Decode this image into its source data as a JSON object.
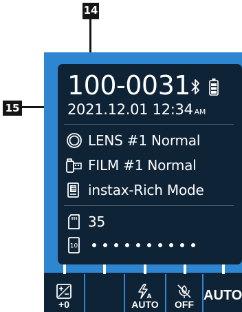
{
  "callouts": {
    "shot_number": "14",
    "date": "15"
  },
  "status": {
    "shot_number": "100-0031",
    "date": "2021.12.01",
    "time": "12:34",
    "ampm": "AM"
  },
  "settings": {
    "lens": "LENS #1 Normal",
    "film": "FILM #1 Normal",
    "mode": "instax-Rich Mode",
    "remaining": "35"
  },
  "film_pack": {
    "remaining_dots": 10
  },
  "buttons": {
    "exposure": "+0",
    "flash": "AUTO",
    "macro": "OFF",
    "auto": "AUTO"
  },
  "icons": {
    "lens": "lens-ring-icon",
    "film": "film-canister-icon",
    "mode": "film-mode-icon",
    "memory": "memory-card-icon",
    "pack": "film-pack-icon",
    "bluetooth": "bluetooth-icon",
    "battery": "battery-icon",
    "exposure": "exposure-compensation-icon",
    "flash": "flash-auto-icon",
    "macro": "macro-off-icon"
  },
  "colors": {
    "frame": "#2e86d1",
    "screen": "#0f2336",
    "callout": "#151515"
  }
}
